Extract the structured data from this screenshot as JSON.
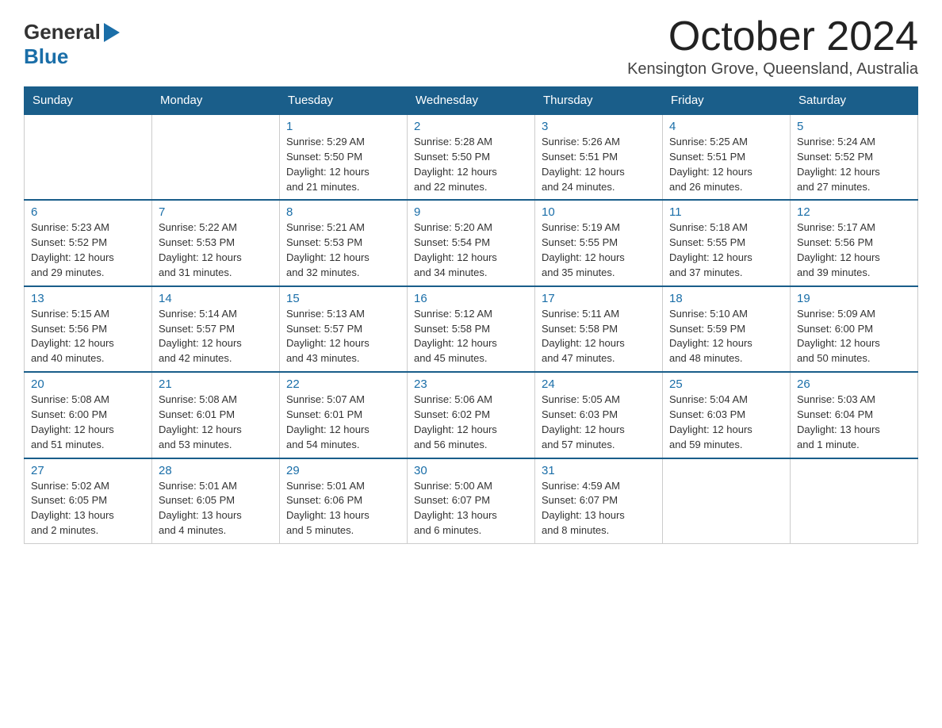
{
  "logo": {
    "general": "General",
    "blue": "Blue"
  },
  "title": {
    "month_year": "October 2024",
    "location": "Kensington Grove, Queensland, Australia"
  },
  "weekdays": [
    "Sunday",
    "Monday",
    "Tuesday",
    "Wednesday",
    "Thursday",
    "Friday",
    "Saturday"
  ],
  "weeks": [
    [
      {
        "day": "",
        "info": ""
      },
      {
        "day": "",
        "info": ""
      },
      {
        "day": "1",
        "info": "Sunrise: 5:29 AM\nSunset: 5:50 PM\nDaylight: 12 hours\nand 21 minutes."
      },
      {
        "day": "2",
        "info": "Sunrise: 5:28 AM\nSunset: 5:50 PM\nDaylight: 12 hours\nand 22 minutes."
      },
      {
        "day": "3",
        "info": "Sunrise: 5:26 AM\nSunset: 5:51 PM\nDaylight: 12 hours\nand 24 minutes."
      },
      {
        "day": "4",
        "info": "Sunrise: 5:25 AM\nSunset: 5:51 PM\nDaylight: 12 hours\nand 26 minutes."
      },
      {
        "day": "5",
        "info": "Sunrise: 5:24 AM\nSunset: 5:52 PM\nDaylight: 12 hours\nand 27 minutes."
      }
    ],
    [
      {
        "day": "6",
        "info": "Sunrise: 5:23 AM\nSunset: 5:52 PM\nDaylight: 12 hours\nand 29 minutes."
      },
      {
        "day": "7",
        "info": "Sunrise: 5:22 AM\nSunset: 5:53 PM\nDaylight: 12 hours\nand 31 minutes."
      },
      {
        "day": "8",
        "info": "Sunrise: 5:21 AM\nSunset: 5:53 PM\nDaylight: 12 hours\nand 32 minutes."
      },
      {
        "day": "9",
        "info": "Sunrise: 5:20 AM\nSunset: 5:54 PM\nDaylight: 12 hours\nand 34 minutes."
      },
      {
        "day": "10",
        "info": "Sunrise: 5:19 AM\nSunset: 5:55 PM\nDaylight: 12 hours\nand 35 minutes."
      },
      {
        "day": "11",
        "info": "Sunrise: 5:18 AM\nSunset: 5:55 PM\nDaylight: 12 hours\nand 37 minutes."
      },
      {
        "day": "12",
        "info": "Sunrise: 5:17 AM\nSunset: 5:56 PM\nDaylight: 12 hours\nand 39 minutes."
      }
    ],
    [
      {
        "day": "13",
        "info": "Sunrise: 5:15 AM\nSunset: 5:56 PM\nDaylight: 12 hours\nand 40 minutes."
      },
      {
        "day": "14",
        "info": "Sunrise: 5:14 AM\nSunset: 5:57 PM\nDaylight: 12 hours\nand 42 minutes."
      },
      {
        "day": "15",
        "info": "Sunrise: 5:13 AM\nSunset: 5:57 PM\nDaylight: 12 hours\nand 43 minutes."
      },
      {
        "day": "16",
        "info": "Sunrise: 5:12 AM\nSunset: 5:58 PM\nDaylight: 12 hours\nand 45 minutes."
      },
      {
        "day": "17",
        "info": "Sunrise: 5:11 AM\nSunset: 5:58 PM\nDaylight: 12 hours\nand 47 minutes."
      },
      {
        "day": "18",
        "info": "Sunrise: 5:10 AM\nSunset: 5:59 PM\nDaylight: 12 hours\nand 48 minutes."
      },
      {
        "day": "19",
        "info": "Sunrise: 5:09 AM\nSunset: 6:00 PM\nDaylight: 12 hours\nand 50 minutes."
      }
    ],
    [
      {
        "day": "20",
        "info": "Sunrise: 5:08 AM\nSunset: 6:00 PM\nDaylight: 12 hours\nand 51 minutes."
      },
      {
        "day": "21",
        "info": "Sunrise: 5:08 AM\nSunset: 6:01 PM\nDaylight: 12 hours\nand 53 minutes."
      },
      {
        "day": "22",
        "info": "Sunrise: 5:07 AM\nSunset: 6:01 PM\nDaylight: 12 hours\nand 54 minutes."
      },
      {
        "day": "23",
        "info": "Sunrise: 5:06 AM\nSunset: 6:02 PM\nDaylight: 12 hours\nand 56 minutes."
      },
      {
        "day": "24",
        "info": "Sunrise: 5:05 AM\nSunset: 6:03 PM\nDaylight: 12 hours\nand 57 minutes."
      },
      {
        "day": "25",
        "info": "Sunrise: 5:04 AM\nSunset: 6:03 PM\nDaylight: 12 hours\nand 59 minutes."
      },
      {
        "day": "26",
        "info": "Sunrise: 5:03 AM\nSunset: 6:04 PM\nDaylight: 13 hours\nand 1 minute."
      }
    ],
    [
      {
        "day": "27",
        "info": "Sunrise: 5:02 AM\nSunset: 6:05 PM\nDaylight: 13 hours\nand 2 minutes."
      },
      {
        "day": "28",
        "info": "Sunrise: 5:01 AM\nSunset: 6:05 PM\nDaylight: 13 hours\nand 4 minutes."
      },
      {
        "day": "29",
        "info": "Sunrise: 5:01 AM\nSunset: 6:06 PM\nDaylight: 13 hours\nand 5 minutes."
      },
      {
        "day": "30",
        "info": "Sunrise: 5:00 AM\nSunset: 6:07 PM\nDaylight: 13 hours\nand 6 minutes."
      },
      {
        "day": "31",
        "info": "Sunrise: 4:59 AM\nSunset: 6:07 PM\nDaylight: 13 hours\nand 8 minutes."
      },
      {
        "day": "",
        "info": ""
      },
      {
        "day": "",
        "info": ""
      }
    ]
  ]
}
